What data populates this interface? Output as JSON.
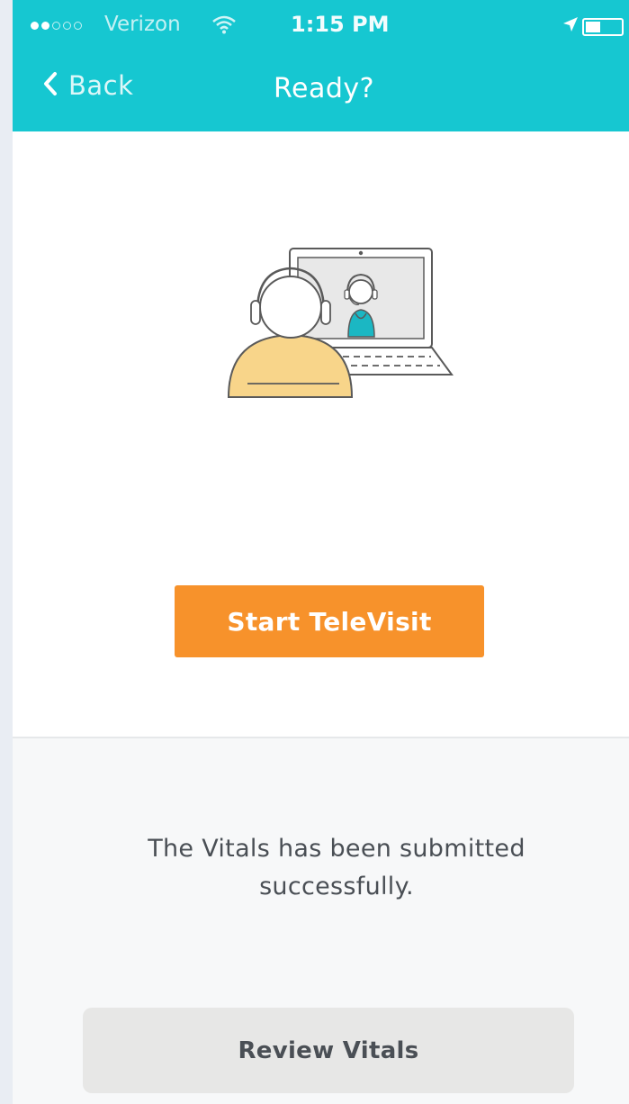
{
  "status_bar": {
    "carrier": "Verizon",
    "time": "1:15 PM",
    "signal_bars_filled": 2,
    "signal_bars_total": 5,
    "icons": [
      "wifi-icon",
      "location-arrow-icon",
      "battery-icon"
    ]
  },
  "nav": {
    "back_label": "Back",
    "back_icon": "chevron-left-icon",
    "title": "Ready?"
  },
  "main": {
    "illustration_icon": "televisit-illustration",
    "start_button_label": "Start TeleVisit"
  },
  "footer": {
    "message": "The Vitals has been submitted successfully.",
    "review_button_label": "Review Vitals"
  },
  "colors": {
    "header": "#16c7d1",
    "primary_button": "#f7922b",
    "secondary_button": "#e7e7e6",
    "patient_body": "#f8d58a",
    "doctor": "#1bb7c3"
  }
}
